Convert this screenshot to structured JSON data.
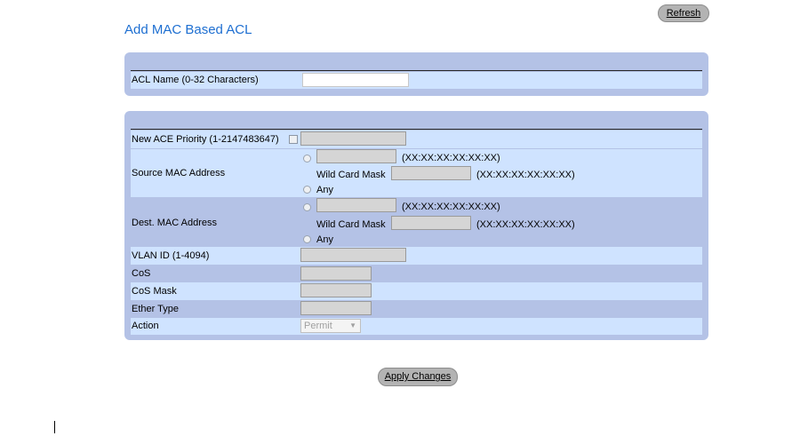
{
  "header": {
    "refresh_label": "Refresh",
    "title": "Add MAC Based ACL"
  },
  "acl_name": {
    "label": "ACL Name (0-32 Characters)",
    "value": ""
  },
  "ace": {
    "priority_label": "New ACE Priority (1-2147483647)",
    "priority_value": "",
    "source_mac": {
      "label": "Source MAC Address",
      "value": "",
      "format_hint": "(XX:XX:XX:XX:XX:XX)",
      "wildcard_label": "Wild Card Mask",
      "wildcard_value": "",
      "wildcard_hint": "(XX:XX:XX:XX:XX:XX)",
      "any_label": "Any"
    },
    "dest_mac": {
      "label": "Dest. MAC Address",
      "value": "",
      "format_hint": "(XX:XX:XX:XX:XX:XX)",
      "wildcard_label": "Wild Card Mask",
      "wildcard_value": "",
      "wildcard_hint": "(XX:XX:XX:XX:XX:XX)",
      "any_label": "Any"
    },
    "vlan_label": "VLAN ID (1-4094)",
    "vlan_value": "",
    "cos_label": "CoS",
    "cos_value": "",
    "cos_mask_label": "CoS Mask",
    "cos_mask_value": "",
    "ether_type_label": "Ether Type",
    "ether_type_value": "",
    "action_label": "Action",
    "action_value": "Permit"
  },
  "footer": {
    "apply_label": "Apply Changes"
  }
}
